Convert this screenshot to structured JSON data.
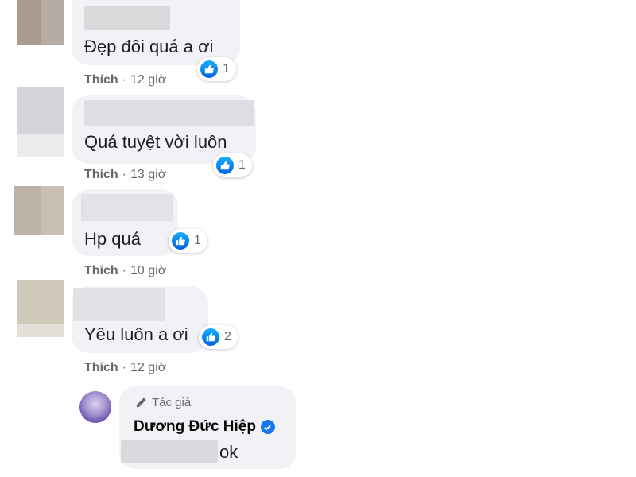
{
  "comments": [
    {
      "text": "Đẹp đôi quá a ơi",
      "reaction_count": "1",
      "like_label": "Thích",
      "separator": "·",
      "time": "12 giờ"
    },
    {
      "text": "Quá tuyệt vời luôn",
      "reaction_count": "1",
      "like_label": "Thích",
      "separator": "·",
      "time": "13 giờ"
    },
    {
      "text": "Hp quá",
      "reaction_count": "1",
      "like_label": "Thích",
      "separator": "·",
      "time": "10 giờ"
    },
    {
      "text": "Yêu luôn a ơi",
      "reaction_count": "2",
      "like_label": "Thích",
      "separator": "·",
      "time": "12 giờ"
    }
  ],
  "reply": {
    "author_badge": "Tác giả",
    "author_name": "Dương Đức Hiệp",
    "text": "ok"
  },
  "colors": {
    "bubble": "#f0f2f5",
    "like_blue": "#1877f2",
    "meta_gray": "#65676b"
  },
  "icons": {
    "reaction": "like-thumb-icon",
    "badge": "pencil-icon",
    "verified": "verified-check-icon"
  }
}
